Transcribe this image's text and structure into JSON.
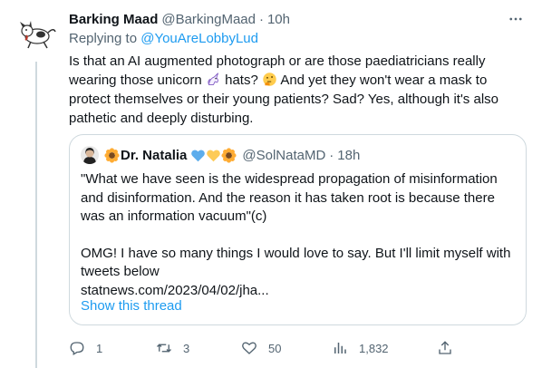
{
  "tweet": {
    "author_name": "Barking Maad",
    "author_handle": "@BarkingMaad",
    "time": "10h",
    "replying_prefix": "Replying to",
    "replying_handle": "@YouAreLobbyLud",
    "text_part1": "Is that an AI augmented photograph or are those paediatricians really wearing those unicorn",
    "text_part2": "hats?",
    "text_part3": "And yet they won't wear a mask to protect themselves or their young patients? Sad? Yes, although it's also pathetic and deeply disturbing."
  },
  "quote": {
    "author_name": "Dr. Natalia",
    "author_handle": "@SolNataMD",
    "time": "18h",
    "para1": "\"What we have seen is the widespread propagation of misinformation and disinformation. And the reason it has taken root is because there was an information vacuum\"(c)",
    "para2": "OMG! I have so many things I would love to say. But I'll limit myself with tweets below",
    "link": "statnews.com/2023/04/02/jha...",
    "show_thread": "Show this thread"
  },
  "actions": {
    "replies": "1",
    "retweets": "3",
    "likes": "50",
    "views": "1,832"
  },
  "icons": [
    "more-icon",
    "reply-icon",
    "retweet-icon",
    "like-icon",
    "views-icon",
    "share-icon",
    "unicorn-emoji",
    "thinking-emoji",
    "sunflower-emoji",
    "blue-heart-emoji",
    "yellow-heart-emoji"
  ],
  "colors": {
    "link": "#1d9bf0",
    "secondary": "#536471",
    "text": "#0f1419",
    "border": "#cfd9de"
  }
}
